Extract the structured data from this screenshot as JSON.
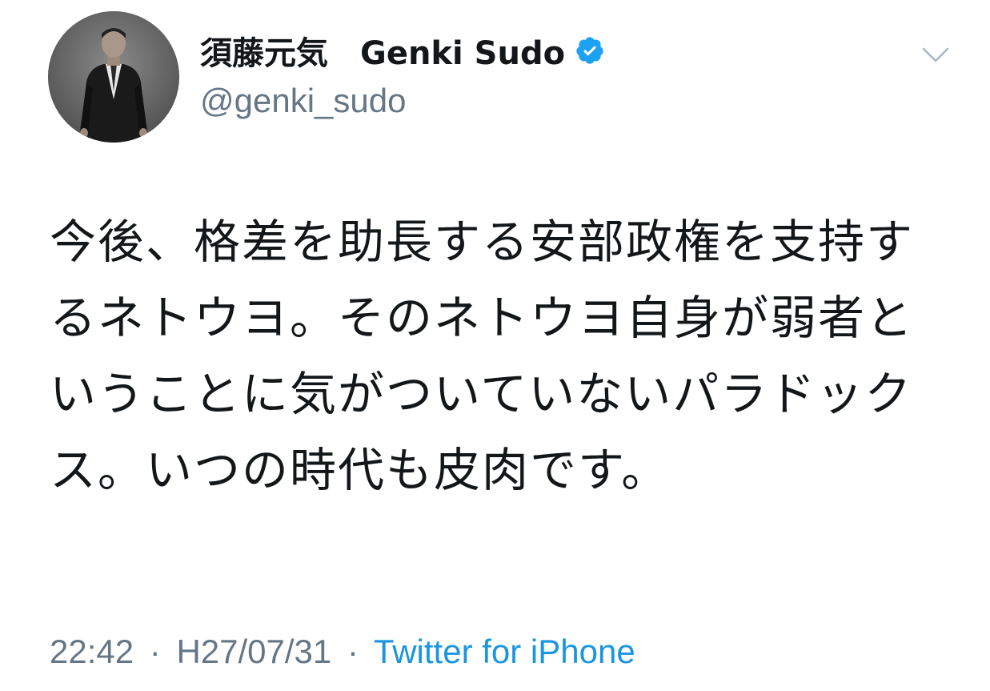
{
  "author": {
    "display_name": "須藤元気　Genki Sudo",
    "handle": "@genki_sudo",
    "verified": true,
    "avatar_icon": "user-avatar-photo"
  },
  "menu": {
    "icon": "chevron-down-icon"
  },
  "tweet": {
    "text": "今後、格差を助長する安部政権を支持するネトウヨ。そのネトウヨ自身が弱者ということに気がついていないパラドックス。いつの時代も皮肉です。"
  },
  "meta": {
    "time": "22:42",
    "separator": "·",
    "date": "H27/07/31",
    "source": "Twitter for iPhone"
  },
  "colors": {
    "text": "#14171a",
    "secondary": "#657786",
    "accent": "#1b95e0",
    "verified": "#1da1f2"
  }
}
